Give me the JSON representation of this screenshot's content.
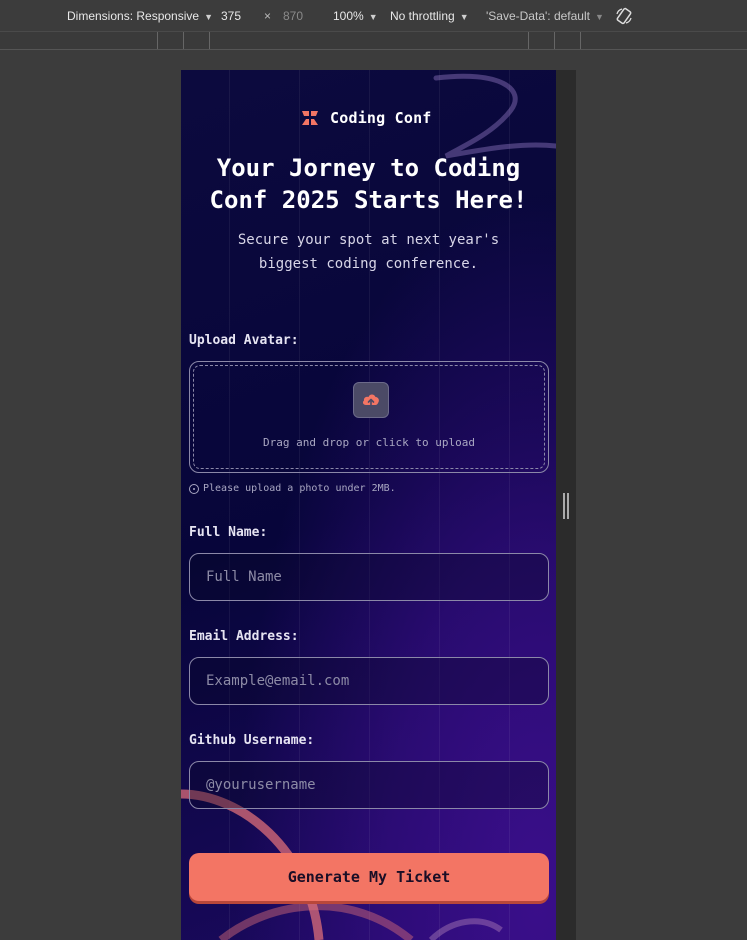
{
  "devtools": {
    "dimensions_label": "Dimensions: Responsive",
    "width": "375",
    "times": "×",
    "height": "870",
    "zoom": "100%",
    "throttling": "No throttling",
    "save_data": "'Save-Data': default"
  },
  "page": {
    "brand": "Coding Conf",
    "headline": "Your Jorney to Coding Conf 2025 Starts Here!",
    "subline": "Secure your spot at next year's biggest coding conference.",
    "colors": {
      "accent": "#f37564",
      "background": "#0c0a3e"
    }
  },
  "form": {
    "avatar_label": "Upload Avatar:",
    "upload_text": "Drag and drop or click to upload",
    "upload_hint": "Please upload a photo under 2MB.",
    "name_label": "Full Name:",
    "name_placeholder": "Full Name",
    "email_label": "Email Address:",
    "email_placeholder": "Example@email.com",
    "github_label": "Github Username:",
    "github_placeholder": "@yourusername",
    "submit_label": "Generate My Ticket"
  }
}
